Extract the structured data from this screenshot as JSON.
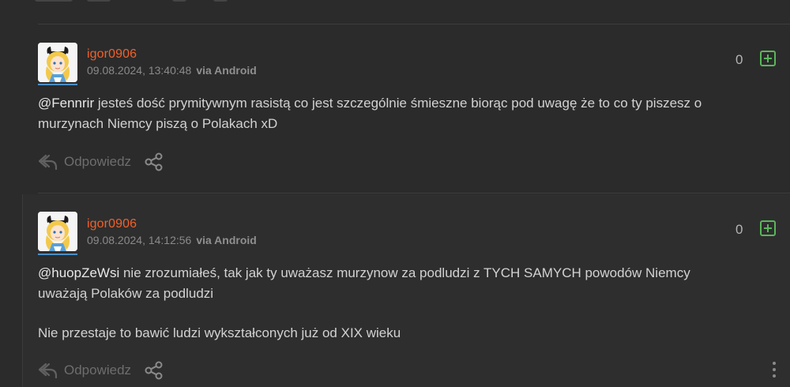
{
  "comments": [
    {
      "username": "igor0906",
      "timestamp": "09.08.2024, 13:40:48",
      "via": "via Android",
      "score": "0",
      "mention": "@Fennrir",
      "text_line1": " jesteś dość prymitywnym rasistą co jest szczególnie śmieszne biorąc pod uwagę że to co ty piszesz o",
      "text_line2": "murzynach Niemcy piszą o Polakach xD",
      "reply_label": "Odpowiedz"
    },
    {
      "username": "igor0906",
      "timestamp": "09.08.2024, 14:12:56",
      "via": "via Android",
      "score": "0",
      "mention": "@huopZeWsi",
      "text_line1": " nie zrozumiałeś, tak jak ty uważasz murzynow za podludzi z TYCH SAMYCH powodów Niemcy",
      "text_line2": "uważają Polaków za podludzi",
      "text_line3": "Nie przestaje to bawić ludzi wykształconych już od XIX wieku",
      "reply_label": "Odpowiedz"
    }
  ],
  "colors": {
    "background": "#2b2b2b",
    "username": "#f0612a",
    "plus_button": "#5bb55b",
    "avatar_underline": "#4a90c8"
  },
  "icons": {
    "reply": "reply-arrow-icon",
    "share": "share-icon",
    "plus": "plus-icon",
    "more": "more-vertical-icon"
  }
}
